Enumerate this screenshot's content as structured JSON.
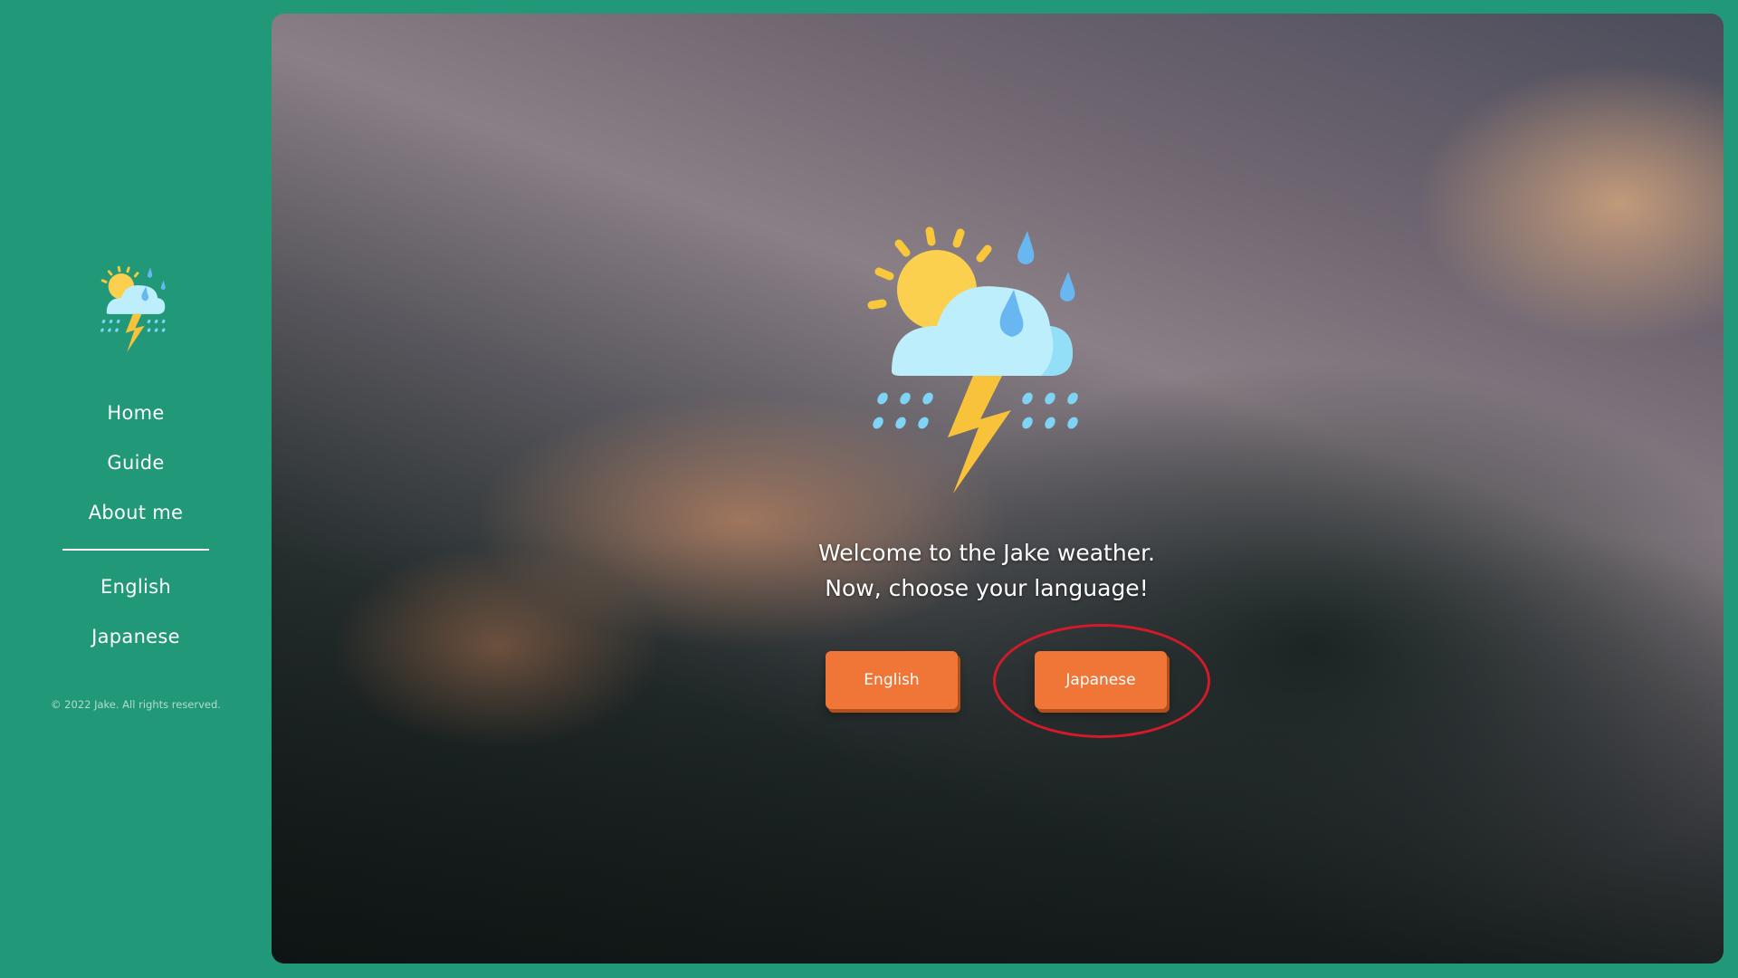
{
  "sidebar": {
    "logo": "weather-storm-logo",
    "nav": [
      {
        "label": "Home"
      },
      {
        "label": "Guide"
      },
      {
        "label": "About me"
      }
    ],
    "languages": [
      {
        "label": "English"
      },
      {
        "label": "Japanese"
      }
    ],
    "copyright": "© 2022 Jake. All rights reserved."
  },
  "main": {
    "icon": "sun-cloud-rain-lightning-icon",
    "welcome_line1": "Welcome to the Jake weather.",
    "welcome_line2": "Now, choose your language!",
    "buttons": {
      "english": "English",
      "japanese": "Japanese"
    }
  },
  "colors": {
    "sidebar_bg": "#219878",
    "button_bg": "#ef7636",
    "highlight": "#d11a2a"
  }
}
